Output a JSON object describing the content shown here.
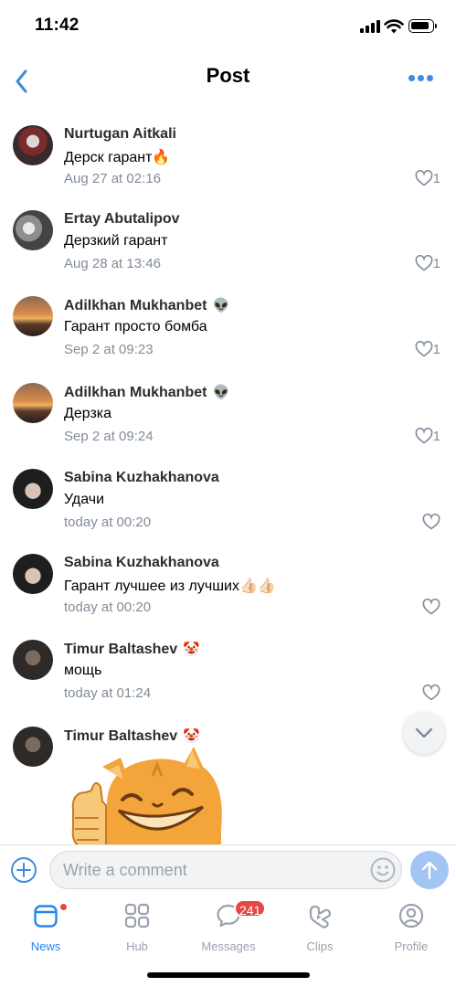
{
  "status_bar": {
    "time": "11:42"
  },
  "nav": {
    "title": "Post"
  },
  "comments": [
    {
      "author": "Nurtugan Aitkali",
      "author_emoji": "",
      "text": "Дерск гарант🔥",
      "date": "Aug 27 at 02:16",
      "likes": "1"
    },
    {
      "author": "Ertay Abutalipov",
      "author_emoji": "",
      "text": "Дерзкий гарант",
      "date": "Aug 28 at 13:46",
      "likes": "1"
    },
    {
      "author": "Adilkhan Mukhanbet",
      "author_emoji": "👽",
      "text": "Гарант просто бомба",
      "date": "Sep 2 at 09:23",
      "likes": "1"
    },
    {
      "author": "Adilkhan Mukhanbet",
      "author_emoji": "👽",
      "text": "Дерзка",
      "date": "Sep 2 at 09:24",
      "likes": "1"
    },
    {
      "author": "Sabina Kuzhakhanova",
      "author_emoji": "",
      "text": "Удачи",
      "date": "today at 00:20",
      "likes": ""
    },
    {
      "author": "Sabina Kuzhakhanova",
      "author_emoji": "",
      "text": "Гарант лучшее из лучших👍🏻👍🏻",
      "date": "today at 00:20",
      "likes": ""
    },
    {
      "author": "Timur Baltashev",
      "author_emoji": "🤡",
      "text": "мощь",
      "date": "today at 01:24",
      "likes": ""
    },
    {
      "author": "Timur Baltashev",
      "author_emoji": "🤡",
      "text": "",
      "date": "",
      "likes": ""
    }
  ],
  "composer": {
    "placeholder": "Write a comment"
  },
  "tabs": [
    {
      "label": "News",
      "icon": "news-icon"
    },
    {
      "label": "Hub",
      "icon": "hub-icon"
    },
    {
      "label": "Messages",
      "icon": "messages-icon",
      "badge": "241"
    },
    {
      "label": "Clips",
      "icon": "clips-icon"
    },
    {
      "label": "Profile",
      "icon": "profile-icon"
    }
  ],
  "colors": {
    "accent": "#2688eb",
    "badge": "#e64646",
    "secondary_text": "#818c99"
  }
}
